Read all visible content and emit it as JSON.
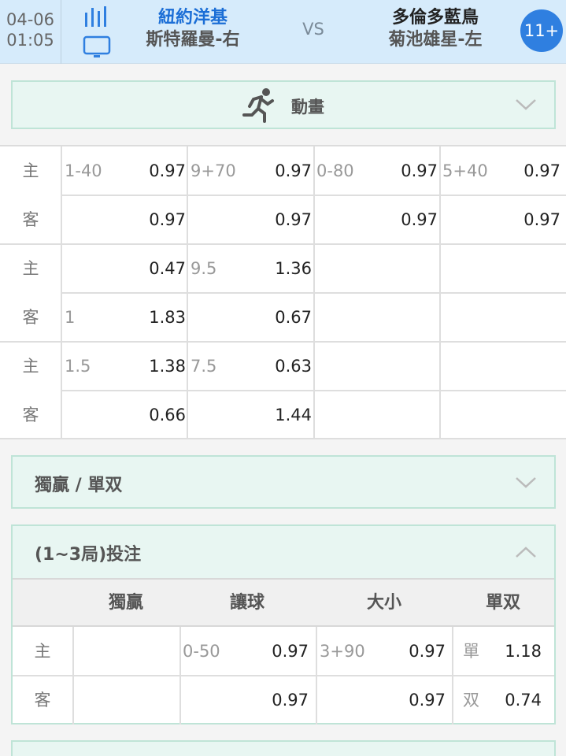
{
  "header": {
    "date": "04-06",
    "time": "01:05",
    "home_team": "紐約洋基",
    "home_pitcher": "斯特羅曼-右",
    "vs": "VS",
    "away_team": "多倫多藍鳥",
    "away_pitcher": "菊池雄星-左",
    "more_label": "11+",
    "icons": [
      "stats-icon",
      "tv-icon"
    ]
  },
  "animation": {
    "label": "動畫",
    "icon": "running-man-icon"
  },
  "odds_grid": {
    "rows": [
      {
        "side": "主",
        "cells": [
          {
            "label": "1-40",
            "value": "0.97"
          },
          {
            "label": "9+70",
            "value": "0.97"
          },
          {
            "label": "0-80",
            "value": "0.97"
          },
          {
            "label": "5+40",
            "value": "0.97"
          }
        ]
      },
      {
        "side": "客",
        "cells": [
          {
            "label": "",
            "value": "0.97"
          },
          {
            "label": "",
            "value": "0.97"
          },
          {
            "label": "",
            "value": "0.97"
          },
          {
            "label": "",
            "value": "0.97"
          }
        ]
      },
      {
        "side": "主",
        "cells": [
          {
            "label": "",
            "value": "0.47"
          },
          {
            "label": "9.5",
            "value": "1.36"
          },
          {
            "label": "",
            "value": ""
          },
          {
            "label": "",
            "value": ""
          }
        ]
      },
      {
        "side": "客",
        "cells": [
          {
            "label": "1",
            "value": "1.83"
          },
          {
            "label": "",
            "value": "0.67"
          },
          {
            "label": "",
            "value": ""
          },
          {
            "label": "",
            "value": ""
          }
        ]
      },
      {
        "side": "主",
        "cells": [
          {
            "label": "1.5",
            "value": "1.38"
          },
          {
            "label": "7.5",
            "value": "0.63"
          },
          {
            "label": "",
            "value": ""
          },
          {
            "label": "",
            "value": ""
          }
        ]
      },
      {
        "side": "客",
        "cells": [
          {
            "label": "",
            "value": "0.66"
          },
          {
            "label": "",
            "value": "1.44"
          },
          {
            "label": "",
            "value": ""
          },
          {
            "label": "",
            "value": ""
          }
        ]
      }
    ]
  },
  "win_oddeven": {
    "title": "獨贏 / 單双"
  },
  "innings": {
    "title": "(1~3局)投注",
    "columns": [
      "獨贏",
      "讓球",
      "大小",
      "單双"
    ],
    "rows": [
      {
        "side": "主",
        "moneyline": "",
        "hcap_label": "0-50",
        "hcap_value": "0.97",
        "ou_label": "3+90",
        "ou_value": "0.97",
        "oe_label": "單",
        "oe_value": "1.18"
      },
      {
        "side": "客",
        "moneyline": "",
        "hcap_label": "",
        "hcap_value": "0.97",
        "ou_label": "",
        "ou_value": "0.97",
        "oe_label": "双",
        "oe_value": "0.74"
      }
    ]
  },
  "colors": {
    "accent_blue": "#2f7fe0",
    "header_bg": "#d6ebfb",
    "panel_bg": "#e8f6f2",
    "panel_border": "#bfe4d7"
  }
}
